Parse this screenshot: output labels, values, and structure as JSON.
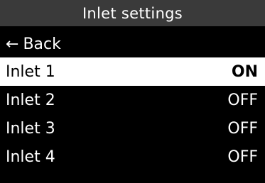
{
  "header": {
    "title": "Inlet settings"
  },
  "back": {
    "icon": "←",
    "label": "Back"
  },
  "items": [
    {
      "label": "Inlet 1",
      "value": "ON"
    },
    {
      "label": "Inlet 2",
      "value": "OFF"
    },
    {
      "label": "Inlet 3",
      "value": "OFF"
    },
    {
      "label": "Inlet 4",
      "value": "OFF"
    }
  ],
  "colors": {
    "background": "#000000",
    "title_bar": "#3a3a3a",
    "selected_row": "#ffffff",
    "text": "#ffffff",
    "selected_text": "#000000"
  }
}
